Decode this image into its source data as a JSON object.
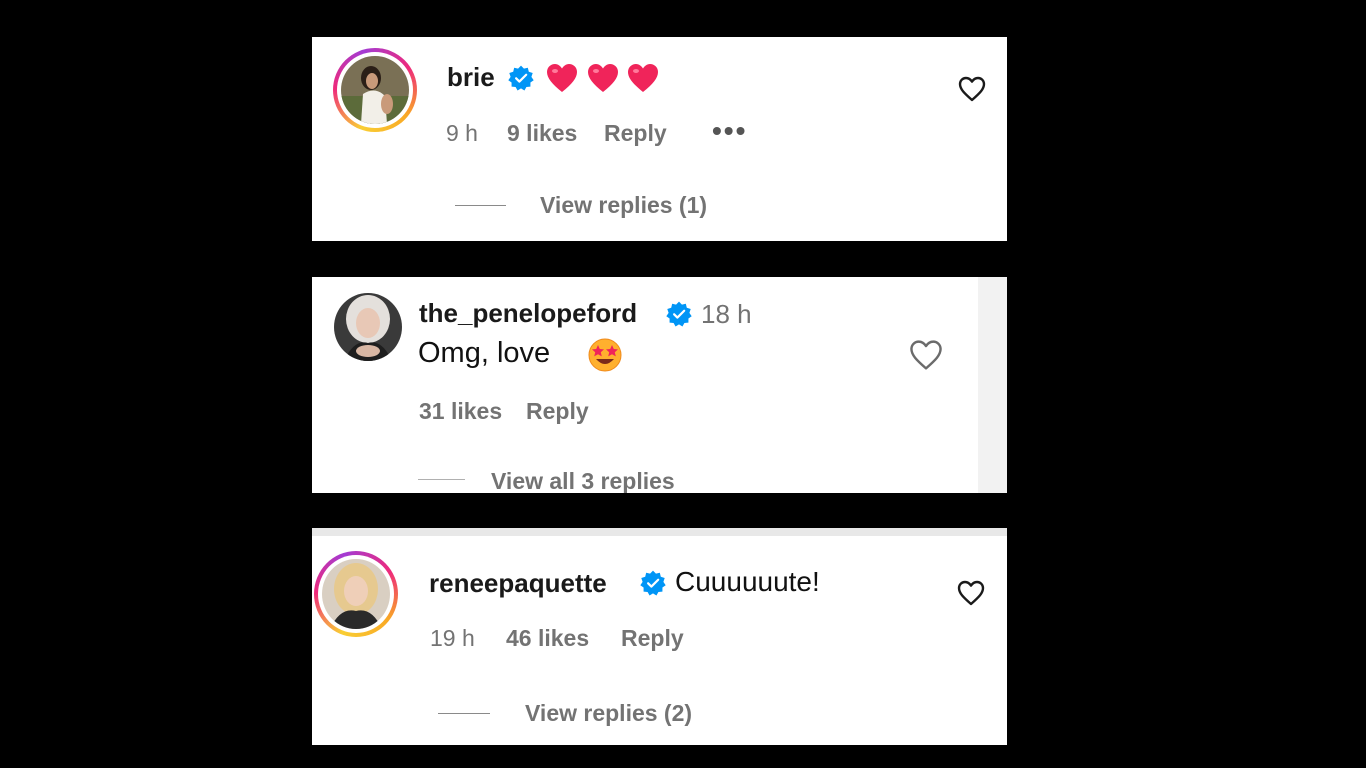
{
  "comments": [
    {
      "username": "brie",
      "text": "",
      "emoji_icons": [
        "red-heart-emoji",
        "red-heart-emoji",
        "red-heart-emoji"
      ],
      "time": "9 h",
      "likes": "9 likes",
      "reply_label": "Reply",
      "more_label": "•••",
      "view_replies": "View replies (1)"
    },
    {
      "username": "the_penelopeford",
      "time": "18 h",
      "text": "Omg, love",
      "emoji_icons": [
        "star-struck-emoji"
      ],
      "likes": "31 likes",
      "reply_label": "Reply",
      "view_replies": "View all 3 replies"
    },
    {
      "username": "reneepaquette",
      "text": "Cuuuuuute!",
      "time": "19 h",
      "likes": "46 likes",
      "reply_label": "Reply",
      "view_replies": "View replies (2)"
    }
  ],
  "colors": {
    "verified_blue": "#0095f6",
    "meta_gray": "#737373",
    "heart_red": "#ff3040",
    "background": "#000000"
  }
}
